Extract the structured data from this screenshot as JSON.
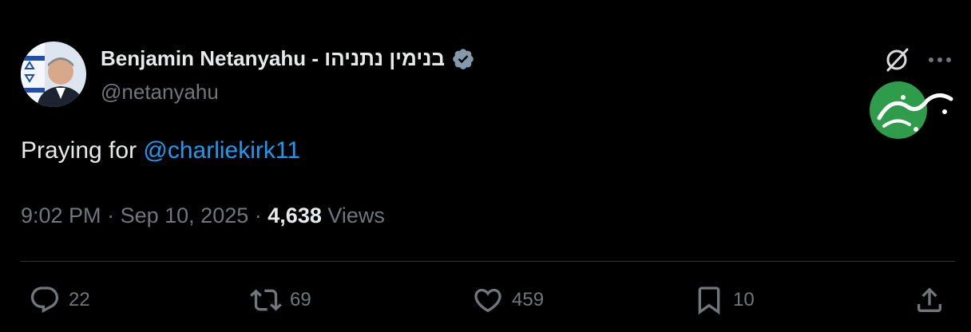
{
  "tweet": {
    "author_name": "Benjamin Netanyahu - בנימין נתניהו",
    "handle": "@netanyahu",
    "text_prefix": "Praying for ",
    "mention": "@charliekirk11",
    "time": "9:02 PM",
    "date": "Sep 10, 2025",
    "views_count": "4,638",
    "views_label": "Views",
    "separator": "·"
  },
  "actions": {
    "replies": "22",
    "reposts": "69",
    "likes": "459",
    "bookmarks": "10"
  },
  "watermark": {
    "text": "خبر فوری",
    "color": "#2e9c4a"
  },
  "icons": [
    "verified-badge-icon",
    "grok-icon",
    "more-icon",
    "reply-icon",
    "repost-icon",
    "like-icon",
    "bookmark-icon",
    "share-icon"
  ],
  "colors": {
    "accent": "#1d9bf0",
    "muted": "#71767b",
    "text": "#e7e9ea",
    "badge": "#829aab"
  }
}
